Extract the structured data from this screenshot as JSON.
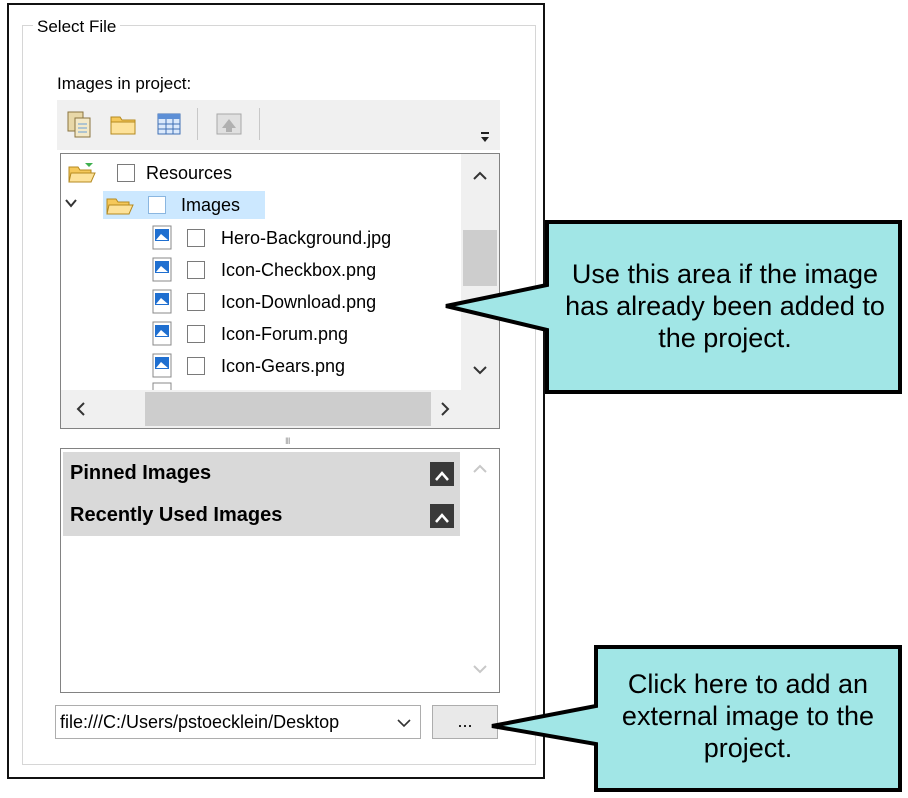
{
  "dialog": {
    "group_title": "Select File",
    "images_label": "Images in project:"
  },
  "toolbar": {
    "buttons": [
      {
        "icon": "copy-icon"
      },
      {
        "icon": "open-folder-icon"
      },
      {
        "icon": "grid-view-icon"
      },
      {
        "icon": "upload-icon"
      }
    ],
    "overflow_icon": "overflow-icon"
  },
  "tree": {
    "root": {
      "label": "Resources",
      "icon": "folder-open-icon"
    },
    "folder": {
      "label": "Images",
      "icon": "folder-open-icon",
      "selected": true
    },
    "files": [
      {
        "label": "Hero-Background.jpg",
        "icon": "image-file-icon"
      },
      {
        "label": "Icon-Checkbox.png",
        "icon": "image-file-icon"
      },
      {
        "label": "Icon-Download.png",
        "icon": "image-file-icon"
      },
      {
        "label": "Icon-Forum.png",
        "icon": "image-file-icon"
      },
      {
        "label": "Icon-Gears.png",
        "icon": "image-file-icon"
      }
    ]
  },
  "pinned_panel": {
    "pinned_label": "Pinned Images",
    "recent_label": "Recently Used Images"
  },
  "path": {
    "value": "file:///C:/Users/pstoecklein/Desktop"
  },
  "browse_button": {
    "label": "..."
  },
  "callouts": {
    "tree_note": "Use this area if the image has already been added to the project.",
    "browse_note": "Click here to add an external image to the project."
  },
  "colors": {
    "callout_fill": "#a1e6e6",
    "selection": "#cce8ff",
    "header_fill": "#d9d9d9"
  }
}
